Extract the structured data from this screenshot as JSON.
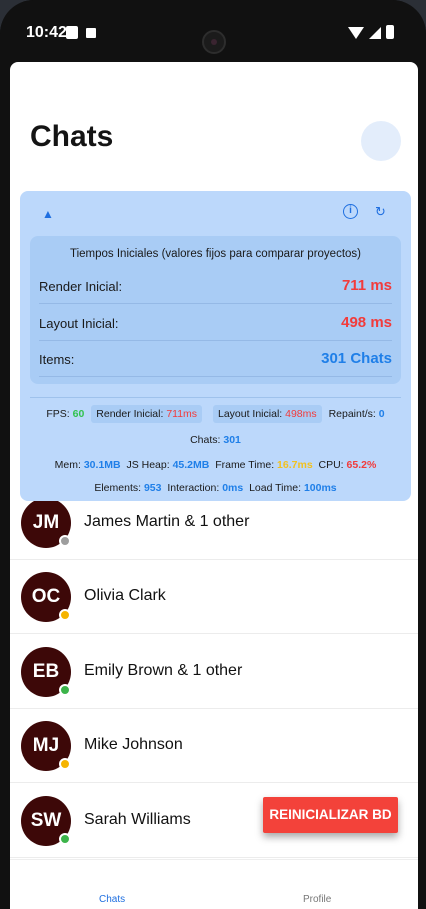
{
  "status_bar": {
    "time": "10:42"
  },
  "header": {
    "title": "Chats"
  },
  "perf": {
    "toggle_icon": "▲",
    "info_icon": "i",
    "refresh_icon": "↻",
    "box_title": "Tiempos Iniciales (valores fijos para comparar proyectos)",
    "rows": [
      {
        "label": "Render Inicial:",
        "value": "711 ms"
      },
      {
        "label": "Layout Inicial:",
        "value": "498 ms"
      },
      {
        "label": "Items:",
        "value": "301 Chats"
      }
    ],
    "fps_label": "FPS:",
    "fps_value": "60",
    "render_label": "Render Inicial:",
    "render_value": "711ms",
    "layout_label": "Layout Inicial:",
    "layout_value": "498ms",
    "repaint_label": "Repaint/s:",
    "repaint_value": "0",
    "chats_label": "Chats:",
    "chats_value": "301",
    "mem_label": "Mem:",
    "mem_value": "30.1MB",
    "heap_label": "JS Heap:",
    "heap_value": "45.2MB",
    "frame_label": "Frame Time:",
    "frame_value": "16.7ms",
    "cpu_label": "CPU:",
    "cpu_value": "65.2%",
    "elements_label": "Elements:",
    "elements_value": "953",
    "interaction_label": "Interaction:",
    "interaction_value": "0ms",
    "load_label": "Load Time:",
    "load_value": "100ms"
  },
  "chats": [
    {
      "initials": "JM",
      "name": "James Martin & 1 other",
      "status_color": "#9e9e9e"
    },
    {
      "initials": "OC",
      "name": "Olivia Clark",
      "status_color": "#f5b400"
    },
    {
      "initials": "EB",
      "name": "Emily Brown & 1 other",
      "status_color": "#3cb44a"
    },
    {
      "initials": "MJ",
      "name": "Mike Johnson",
      "status_color": "#f5b400"
    },
    {
      "initials": "SW",
      "name": "Sarah Williams",
      "status_color": "#3cb44a"
    }
  ],
  "fab": {
    "label": "REINICIALIZAR BD"
  },
  "tabs": {
    "chats": "Chats",
    "profile": "Profile"
  }
}
